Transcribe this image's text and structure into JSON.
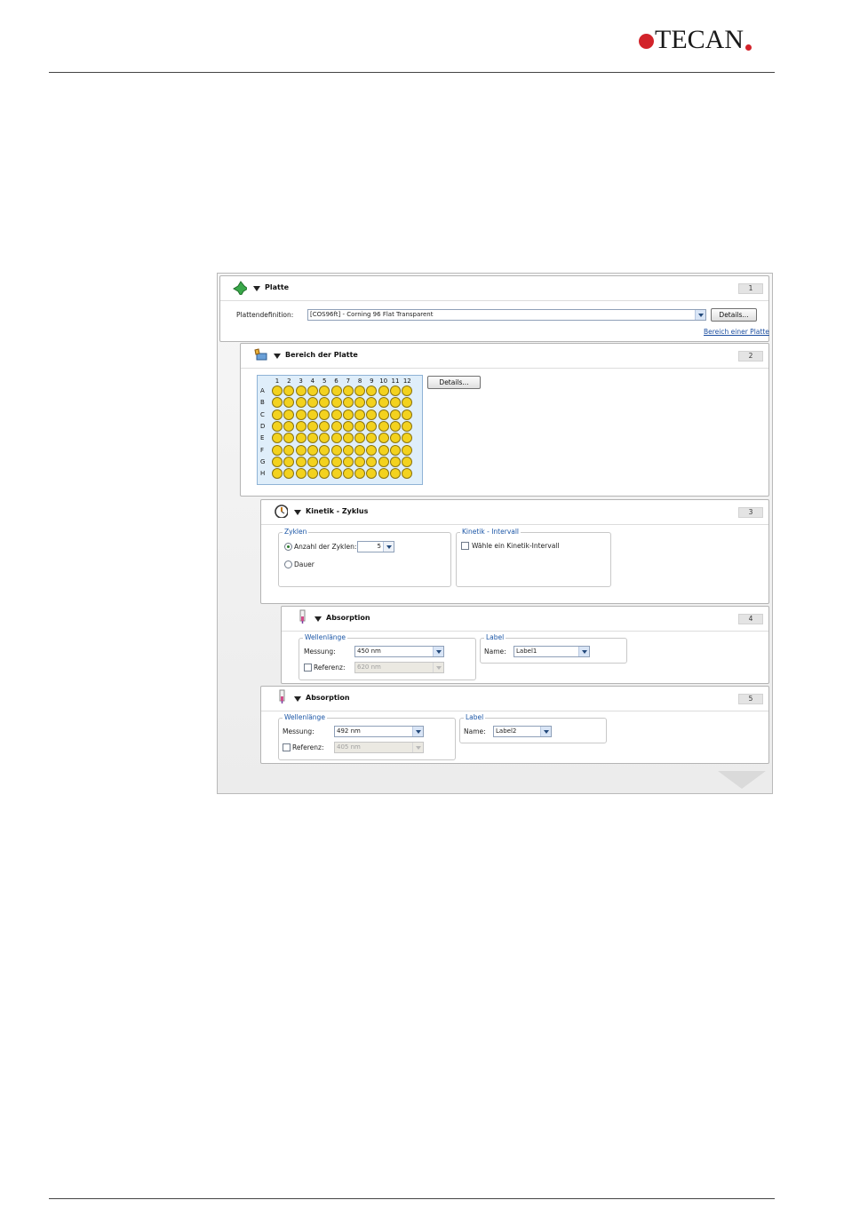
{
  "brand": {
    "name": "TECAN",
    "color": "#d2232a"
  },
  "panels": [
    {
      "title": "Platte",
      "number": "1",
      "icon": "plate-icon",
      "label": "Plattendefinition:",
      "definition": "[COS96ft] - Corning 96 Flat Transparent",
      "details": "Details...",
      "link": "Bereich einer Platte"
    },
    {
      "title": "Bereich der Platte",
      "number": "2",
      "icon": "plate-range-icon",
      "details": "Details...",
      "columns": [
        "1",
        "2",
        "3",
        "4",
        "5",
        "6",
        "7",
        "8",
        "9",
        "10",
        "11",
        "12"
      ],
      "rows": [
        "A",
        "B",
        "C",
        "D",
        "E",
        "F",
        "G",
        "H"
      ]
    },
    {
      "title": "Kinetik - Zyklus",
      "number": "3",
      "icon": "kinetic-cycle-icon",
      "zyklen_label": "Zyklen",
      "anzahl_label": "Anzahl der Zyklen:",
      "anzahl_value": "5",
      "dauer_label": "Dauer",
      "interval_label": "Kinetik - Intervall",
      "interval_checkbox": "Wähle ein Kinetik-Intervall"
    },
    {
      "title": "Absorption",
      "number": "4",
      "icon": "absorption-icon",
      "wellenlaenge_label": "Wellenlänge",
      "messung_label": "Messung:",
      "messung_value": "450 nm",
      "referenz_label": "Referenz:",
      "referenz_value": "620 nm",
      "label_group": "Label",
      "name_label": "Name:",
      "name_value": "Label1"
    },
    {
      "title": "Absorption",
      "number": "5",
      "icon": "absorption-icon",
      "wellenlaenge_label": "Wellenlänge",
      "messung_label": "Messung:",
      "messung_value": "492 nm",
      "referenz_label": "Referenz:",
      "referenz_value": "405 nm",
      "label_group": "Label",
      "name_label": "Name:",
      "name_value": "Label2"
    }
  ]
}
